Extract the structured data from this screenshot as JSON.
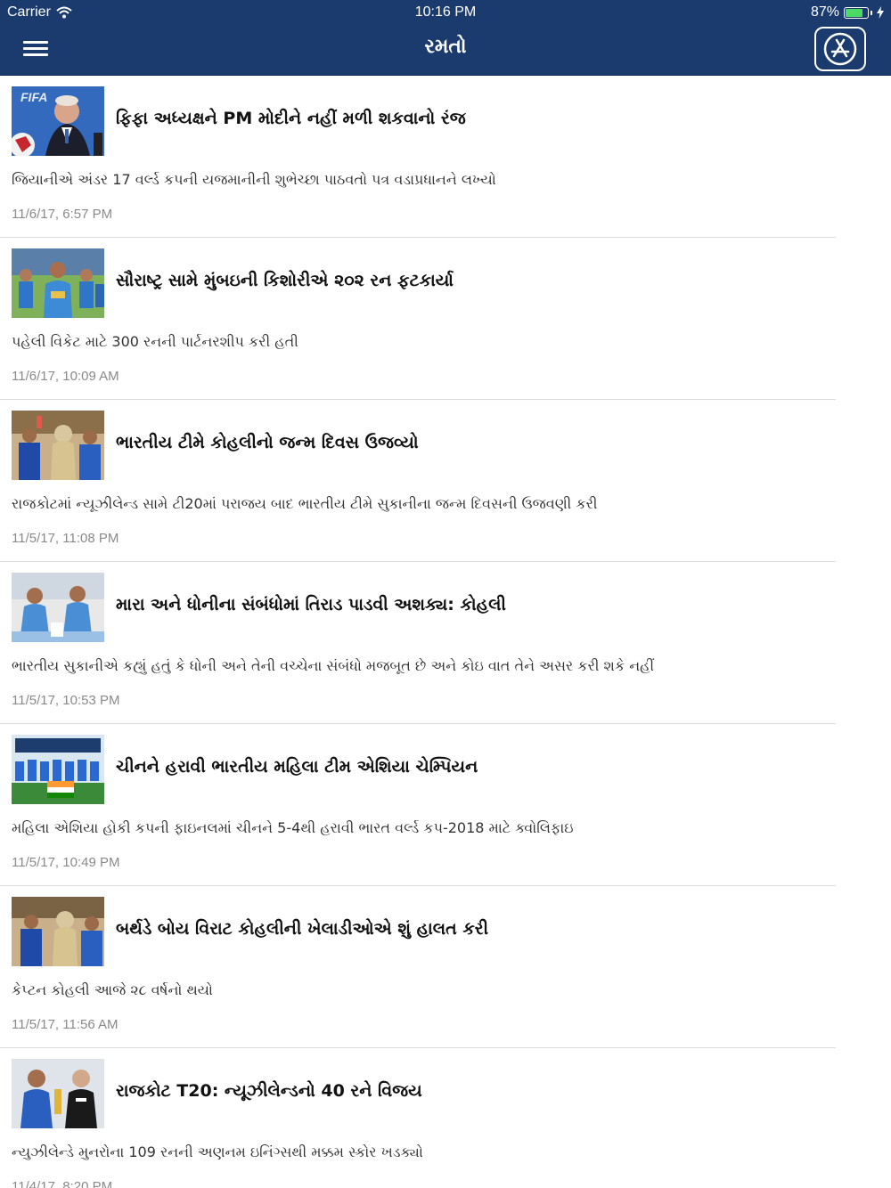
{
  "status_bar": {
    "carrier": "Carrier",
    "time": "10:16 PM",
    "battery": "87%",
    "battery_level": 0.87,
    "battery_color": "#4cd964"
  },
  "nav": {
    "title": "રમતો",
    "menu_icon": "hamburger-menu-icon",
    "store_icon": "app-store-icon",
    "background": "#1b3b6f"
  },
  "articles": [
    {
      "headline": "ફિફા અધ્યક્ષને PM મોદીને નહીં મળી શકવાનો રંજ",
      "summary": "જિયાનીએ અંડર 17 વર્લ્ડ કપની યજમાનીની શુભેચ્છા પાઠવતો પત્ર વડાપ્રધાનને લખ્યો",
      "date": "11/6/17, 6:57 PM",
      "thumb_caption": "FIFA"
    },
    {
      "headline": "સૌરાષ્ટ્ર સામે મુંબઇની કિશોરીએ ૨૦૨ રન ફટકાર્યા",
      "summary": "પહેલી વિકેટ માટે 300 રનની પાર્ટનરશીપ કરી હતી",
      "date": "11/6/17, 10:09 AM"
    },
    {
      "headline": "ભારતીય ટીમે કોહલીનો જન્મ દિવસ ઉજવ્યો",
      "summary": "રાજકોટમાં ન્યૂઝીલેન્ડ સામે ટી20માં પરાજય બાદ ભારતીય ટીમે સુકાનીના જન્મ દિવસની ઉજવણી કરી",
      "date": "11/5/17, 11:08 PM"
    },
    {
      "headline": "મારા અને ધોનીના સંબંધોમાં તિરાડ પાડવી અશક્ય: કોહલી",
      "summary": "ભારતીય સુકાનીએ કહ્યું હતું કે ધોની અને તેની વચ્ચેના સંબંધો મજબૂત છે અને કોઇ વાત તેને અસર કરી શકે નહીં",
      "date": "11/5/17, 10:53 PM"
    },
    {
      "headline": "ચીનને હરાવી ભારતીય મહિલા ટીમ એશિયા ચેમ્પિયન",
      "summary": "મહિલા એશિયા હોકી કપની ફાઇનલમાં ચીનને 5-4થી હરાવી ભારત વર્લ્ડ કપ-2018 માટે ક્વોલિફાઇ",
      "date": "11/5/17, 10:49 PM"
    },
    {
      "headline": "બર્થડે બોય વિરાટ કોહલીની ખેલાડીઓએ શું હાલત કરી",
      "summary": "કેપ્ટન કોહલી આજે ૨૮ વર્ષનો થયો",
      "date": "11/5/17, 11:56 AM"
    },
    {
      "headline": "રાજકોટ T20: ન્યૂઝીલેન્ડનો 40 રને વિજય",
      "summary": "ન્યુઝીલેન્ડે મુનરોના 109 રનની અણનમ ઇનિંગ્સથી મક્કમ સ્કોર ખડક્યો",
      "date": "11/4/17, 8:20 PM"
    }
  ]
}
